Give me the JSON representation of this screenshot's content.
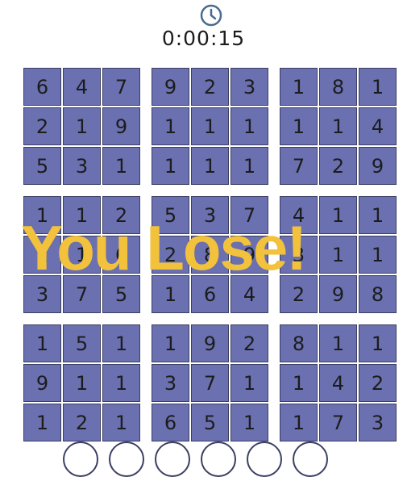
{
  "timer": {
    "time": "0:00:15",
    "icon": "clock-icon"
  },
  "overlay": {
    "message": "You Lose!"
  },
  "colors": {
    "cell": "#6a70b0",
    "overlay": "#f2c23c",
    "icon": "#4a6a8f"
  },
  "board": [
    [
      [
        "6",
        "4",
        "7"
      ],
      [
        "2",
        "1",
        "9"
      ],
      [
        "5",
        "3",
        "1"
      ]
    ],
    [
      [
        "9",
        "2",
        "3"
      ],
      [
        "1",
        "1",
        "1"
      ],
      [
        "1",
        "1",
        "1"
      ]
    ],
    [
      [
        "1",
        "8",
        "1"
      ],
      [
        "1",
        "1",
        "4"
      ],
      [
        "7",
        "2",
        "9"
      ]
    ],
    [
      [
        "1",
        "1",
        "2"
      ],
      [
        "1",
        "1",
        "6"
      ],
      [
        "3",
        "7",
        "5"
      ]
    ],
    [
      [
        "5",
        "3",
        "7"
      ],
      [
        "2",
        "8",
        "9"
      ],
      [
        "1",
        "6",
        "4"
      ]
    ],
    [
      [
        "4",
        "1",
        "1"
      ],
      [
        "3",
        "1",
        "1"
      ],
      [
        "2",
        "9",
        "8"
      ]
    ],
    [
      [
        "1",
        "5",
        "1"
      ],
      [
        "9",
        "1",
        "1"
      ],
      [
        "1",
        "2",
        "1"
      ]
    ],
    [
      [
        "1",
        "9",
        "2"
      ],
      [
        "3",
        "7",
        "1"
      ],
      [
        "6",
        "5",
        "1"
      ]
    ],
    [
      [
        "8",
        "1",
        "1"
      ],
      [
        "1",
        "4",
        "2"
      ],
      [
        "1",
        "7",
        "3"
      ]
    ]
  ]
}
